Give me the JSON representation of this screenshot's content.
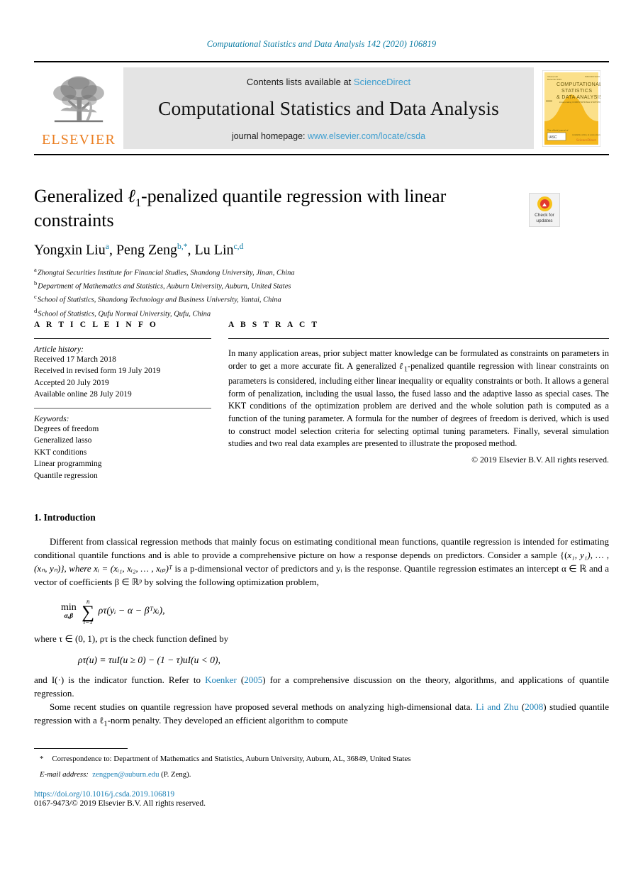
{
  "running_head": "Computational Statistics and Data Analysis 142 (2020) 106819",
  "masthead": {
    "contents_prefix": "Contents lists available at ",
    "sciencedirect": "ScienceDirect",
    "journal_title": "Computational Statistics and Data Analysis",
    "homepage_prefix": "journal homepage: ",
    "homepage_url": "www.elsevier.com/locate/csda",
    "publisher": "ELSEVIER",
    "cover": {
      "line1": "COMPUTATIONAL",
      "line2": "STATISTICS",
      "line3": "& DATA ANALYSIS",
      "subtitle": "incorporating COMPUTATIONAL STATISTICS",
      "badge_left": "The official journal of",
      "badge_right": "ScienceDirect",
      "bg_color": "#f7c948"
    }
  },
  "title": {
    "part1": "Generalized ",
    "ell": "ℓ",
    "sub": "1",
    "part2": "-penalized quantile regression with linear constraints"
  },
  "crossmark": {
    "line1": "Check for",
    "line2": "updates"
  },
  "authors": [
    {
      "name": "Yongxin Liu",
      "sup": "a",
      "sep": ", "
    },
    {
      "name": "Peng Zeng",
      "sup": "b,*",
      "sep": ", "
    },
    {
      "name": "Lu Lin",
      "sup": "c,d",
      "sep": ""
    }
  ],
  "affiliations": [
    {
      "mark": "a",
      "text": "Zhongtai Securities Institute for Financial Studies, Shandong University, Jinan, China"
    },
    {
      "mark": "b",
      "text": "Department of Mathematics and Statistics, Auburn University, Auburn, United States"
    },
    {
      "mark": "c",
      "text": "School of Statistics, Shandong Technology and Business University, Yantai, China"
    },
    {
      "mark": "d",
      "text": "School of Statistics, Qufu Normal University, Qufu, China"
    }
  ],
  "article_info": {
    "heading": "A R T I C L E   I N F O",
    "history_title": "Article history:",
    "history": [
      "Received 17 March 2018",
      "Received in revised form 19 July 2019",
      "Accepted 20 July 2019",
      "Available online 28 July 2019"
    ],
    "keywords_title": "Keywords:",
    "keywords": [
      "Degrees of freedom",
      "Generalized lasso",
      "KKT conditions",
      "Linear programming",
      "Quantile regression"
    ]
  },
  "abstract": {
    "heading": "A B S T R A C T",
    "p1_a": "In many application areas, prior subject matter knowledge can be formulated as constraints on parameters in order to get a more accurate fit. A generalized ",
    "p1_ell": "ℓ",
    "p1_sub": "1",
    "p1_b": "-penalized quantile regression with linear constraints on parameters is considered, including either linear inequality or equality constraints or both. It allows a general form of penalization, including the usual lasso, the fused lasso and the adaptive lasso as special cases. The KKT conditions of the optimization problem are derived and the whole solution path is computed as a function of the tuning parameter. A formula for the number of degrees of freedom is derived, which is used to construct model selection criteria for selecting optimal tuning parameters. Finally, several simulation studies and two real data examples are presented to illustrate the proposed method.",
    "copyright": "© 2019 Elsevier B.V. All rights reserved."
  },
  "body": {
    "section_heading": "1. Introduction",
    "para1_a": "Different from classical regression methods that mainly focus on estimating conditional mean functions, quantile regression is intended for estimating conditional quantile functions and is able to provide a comprehensive picture on how a response depends on predictors. Consider a sample {(",
    "para1_sample": "x₁, y₁), … , (xₙ, yₙ)}, where xᵢ = (xᵢ₁, xᵢ₂, … , xᵢₚ)ᵀ",
    "para1_b": " is a p-dimensional vector of predictors and yᵢ is the response. Quantile regression estimates an intercept α ∈ ℝ and a vector of coefficients β ∈ ℝᵖ by solving the following optimization problem,",
    "eq1": {
      "min_label": "min",
      "min_sub": "α,β",
      "sum_upper": "n",
      "sum_lower": "i=1",
      "body": "ρτ(yᵢ − α − βᵀxᵢ),"
    },
    "para2": "where τ ∈ (0, 1), ρτ is the check function defined by",
    "eq2": "ρτ(u) = τuI(u ≥ 0) − (1 − τ)uI(u < 0),",
    "para3_a": "and I(·) is the indicator function. Refer to ",
    "para3_cite1": "Koenker",
    "para3_b": " (",
    "para3_year1": "2005",
    "para3_c": ") for a comprehensive discussion on the theory, algorithms, and applications of quantile regression.",
    "para4_a": "Some recent studies on quantile regression have proposed several methods on analyzing high-dimensional data. ",
    "para4_cite": "Li and Zhu",
    "para4_b": " (",
    "para4_year": "2008",
    "para4_c": ") studied quantile regression with a ",
    "para4_ell": "ℓ",
    "para4_sub": "1",
    "para4_d": "-norm penalty. They developed an efficient algorithm to compute"
  },
  "footnote": {
    "star": "*",
    "correspondence": "Correspondence to: Department of Mathematics and Statistics, Auburn University, Auburn, AL, 36849, United States",
    "email_label": "E-mail address:",
    "email": "zengpen@auburn.edu",
    "email_suffix": " (P. Zeng)."
  },
  "footer": {
    "doi": "https://doi.org/10.1016/j.csda.2019.106819",
    "issn": "0167-9473/© 2019 Elsevier B.V. All rights reserved."
  },
  "colors": {
    "link_blue": "#1a7fb5",
    "sd_blue": "#3f9fd0",
    "elsevier_orange": "#eb7f22",
    "cover_yellow": "#f7c948"
  }
}
